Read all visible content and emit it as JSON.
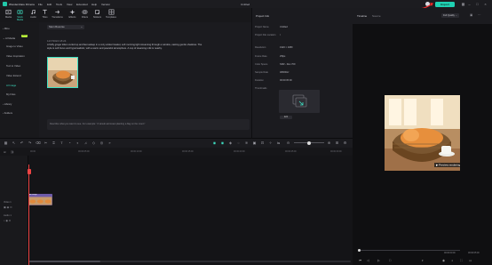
{
  "app": {
    "name": "Wondershare Filmora",
    "menus": [
      "File",
      "Edit",
      "Tools",
      "View",
      "Extended",
      "Help",
      "Version"
    ],
    "doc_title": "Untitled",
    "export_label": "Export"
  },
  "toolbar": {
    "tabs": [
      {
        "label": "Media",
        "icon": "media-icon"
      },
      {
        "label": "Stock Media",
        "icon": "stock-media-icon"
      },
      {
        "label": "Audio",
        "icon": "audio-icon"
      },
      {
        "label": "Titles",
        "icon": "titles-icon"
      },
      {
        "label": "Transitions",
        "icon": "transitions-icon"
      },
      {
        "label": "Effects",
        "icon": "effects-icon"
      },
      {
        "label": "Filters",
        "icon": "filters-icon"
      },
      {
        "label": "Stickers",
        "icon": "stickers-icon"
      },
      {
        "label": "Templates",
        "icon": "templates-icon"
      }
    ]
  },
  "sidebar": {
    "mine": "Mine",
    "ai_media": "AI Media",
    "new_badge": "NEW",
    "items": [
      "Image to Video",
      "Video Inspiration",
      "Text to Video",
      "Video Extend",
      "AI Image",
      "My Files"
    ],
    "library": "Library",
    "folders": "Folders"
  },
  "ai_image": {
    "dropdown": "Stem Reverse",
    "date": "11/7/2024 18:24",
    "prompt_text": "A fluffy ginger kitten curled up and fast asleep in a cozy wicker basket, soft morning light streaming through a window, casting gentle shadows. The style is soft focus and hyperrealistic, with a warm and peaceful atmosphere. A cup of steaming milk is nearby.",
    "input_placeholder": "Describe what you want to see. For example: \"A tanuki astronaut planting a flag on the moon\""
  },
  "project_info": {
    "header": "Project Info",
    "rows": [
      {
        "k": "Project Name",
        "v": "Untitled"
      },
      {
        "k": "Project File Location",
        "v": "/"
      },
      {
        "k": "Resolution",
        "v": "1920 × 1080"
      },
      {
        "k": "Frame Rate",
        "v": "25fps"
      },
      {
        "k": "Color Space",
        "v": "SDR - Rec.709"
      },
      {
        "k": "Sample Rate",
        "v": "48000Hz"
      },
      {
        "k": "Duration",
        "v": "00:00:05:00"
      },
      {
        "k": "Thumbnails",
        "v": ""
      }
    ],
    "edit_label": "Edit"
  },
  "player": {
    "tabs": [
      "Timeline",
      "Source"
    ],
    "quality": "Full Quality",
    "time_current": "00:00:00:00",
    "time_total": "00:00:05:00"
  },
  "timeline": {
    "ticks": [
      "00:00",
      "00:00:05:00",
      "00:00:10:00",
      "00:00:15:00",
      "00:00:20:00",
      "00:00:25:00",
      "00:00:30:00",
      "00:00:35:00"
    ],
    "tracks": [
      "Video 1",
      "Audio 1"
    ],
    "clip_label": "AI image"
  },
  "colors": {
    "accent": "#1fd0b2",
    "playhead": "#ee4444",
    "clip": "#5a4a8c"
  }
}
